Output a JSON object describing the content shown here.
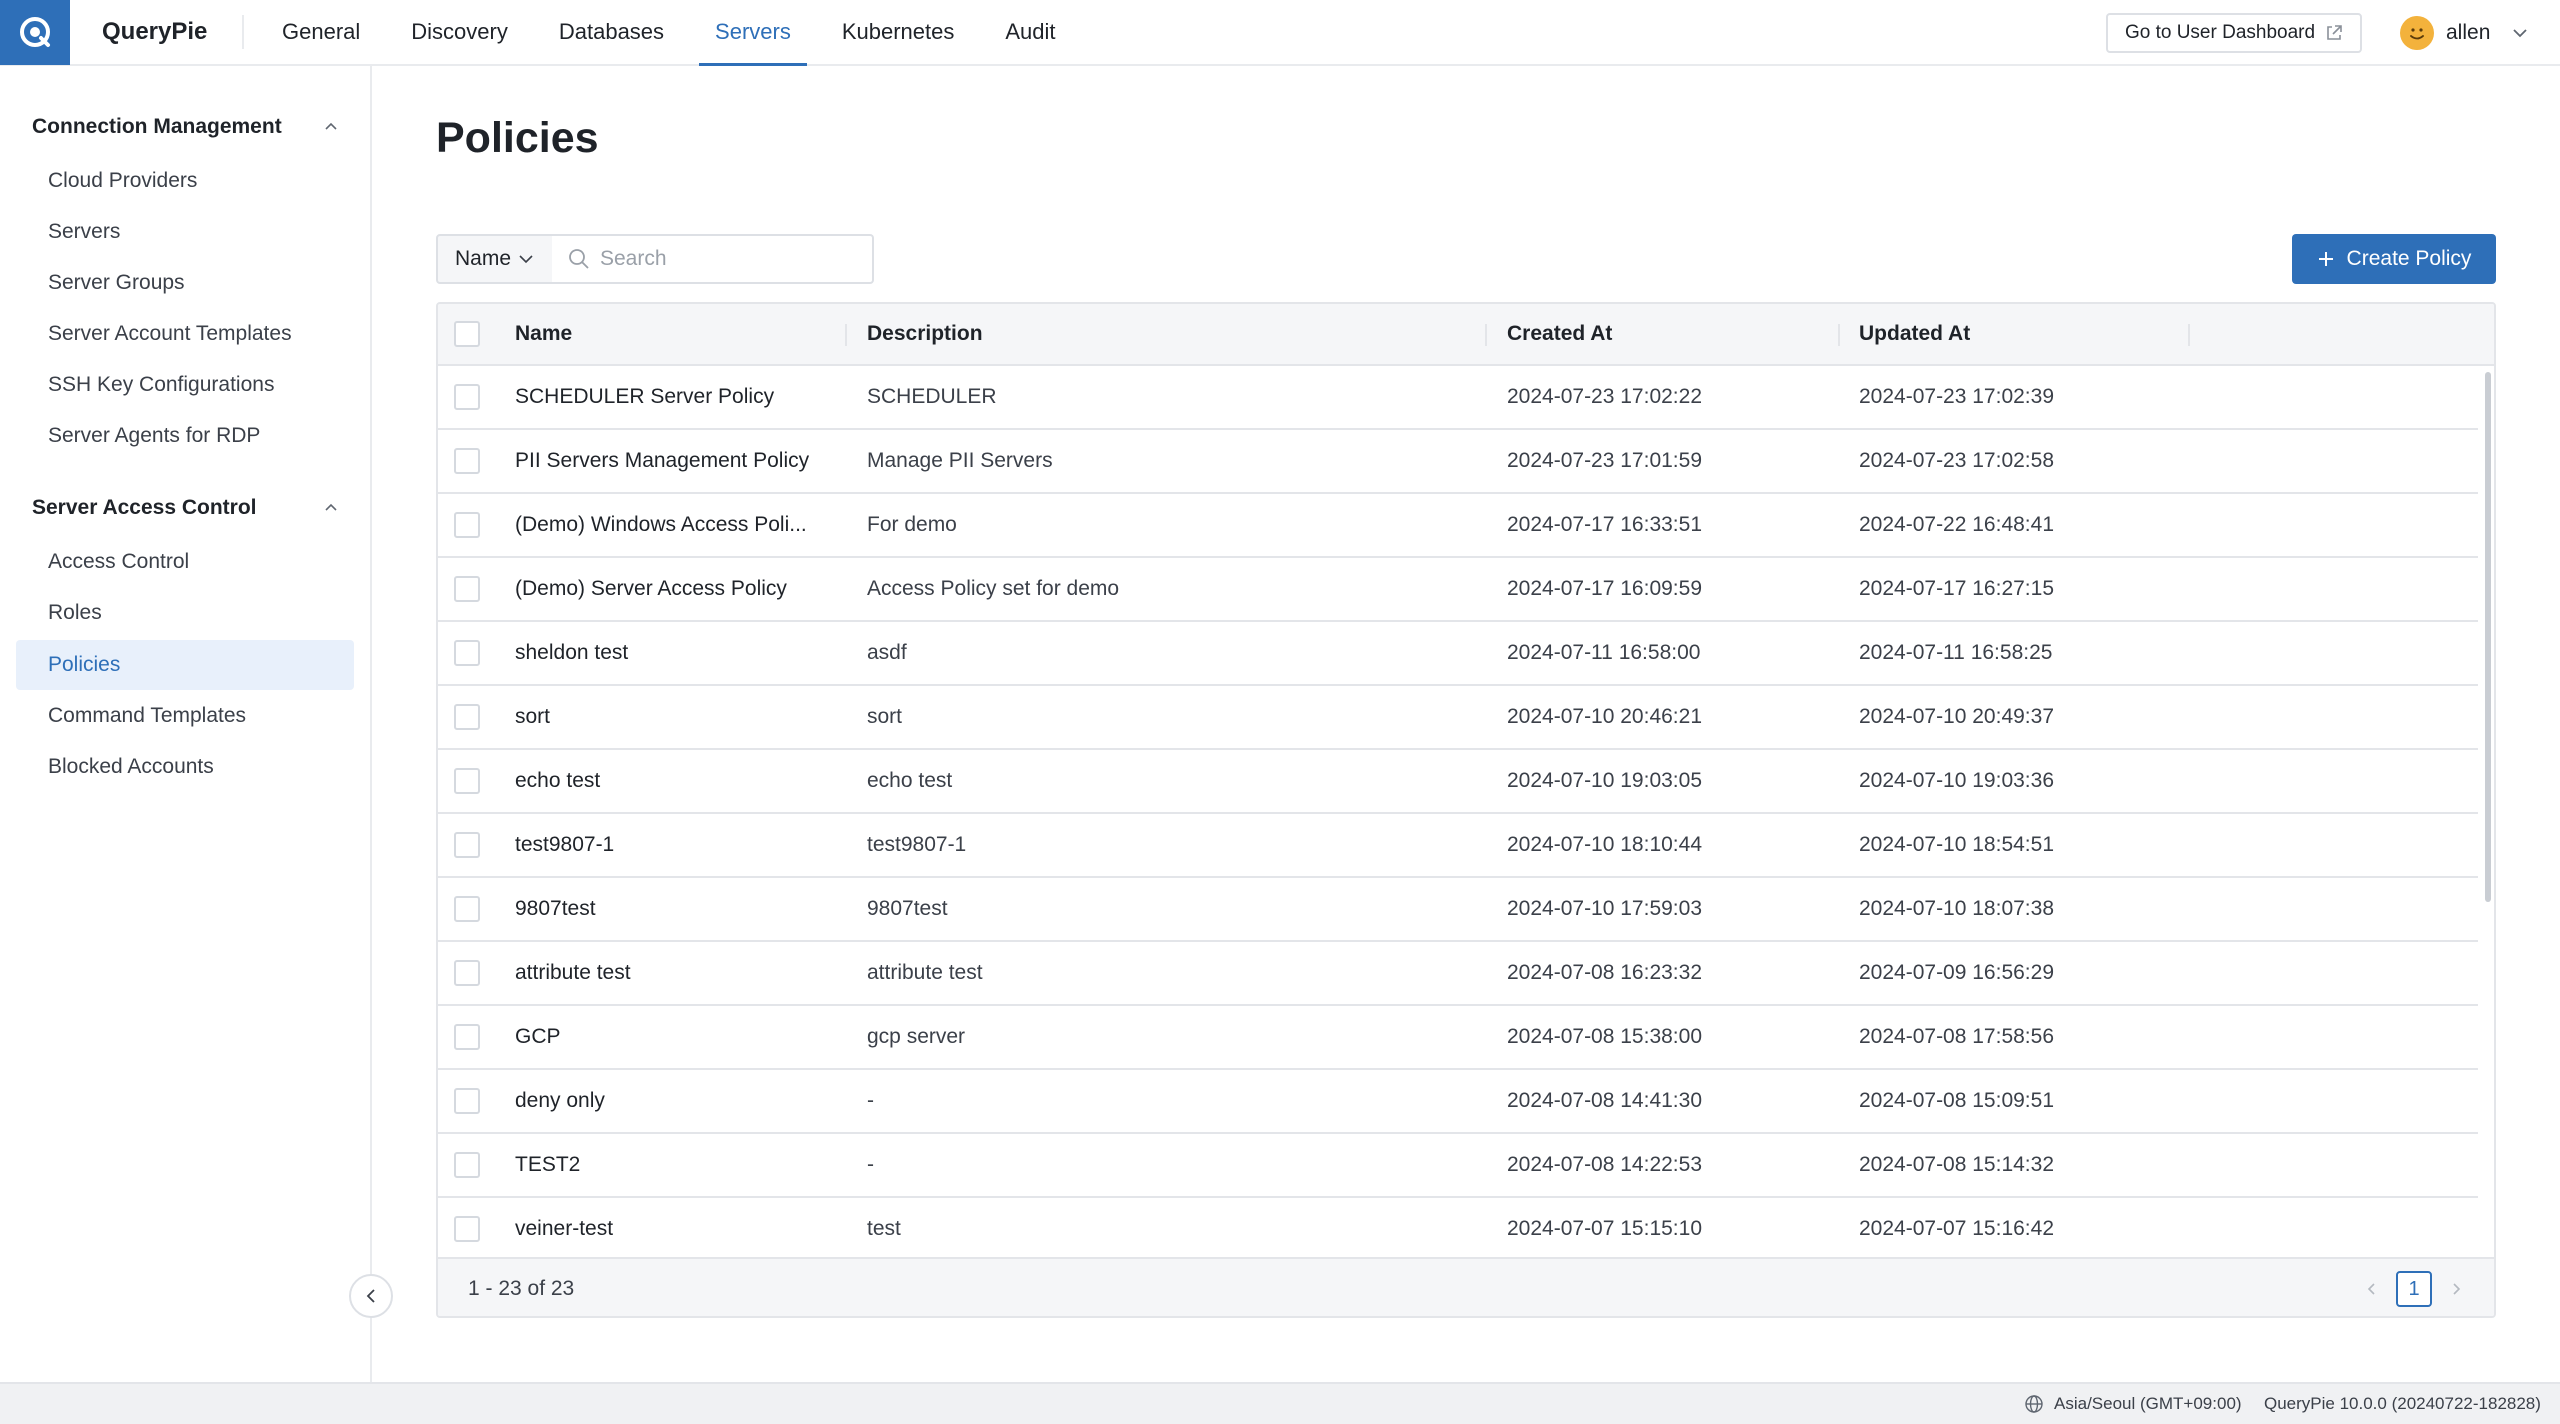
{
  "app": {
    "brand": "QueryPie"
  },
  "nav": [
    {
      "label": "General",
      "active": false
    },
    {
      "label": "Discovery",
      "active": false
    },
    {
      "label": "Databases",
      "active": false
    },
    {
      "label": "Servers",
      "active": true
    },
    {
      "label": "Kubernetes",
      "active": false
    },
    {
      "label": "Audit",
      "active": false
    }
  ],
  "header": {
    "dashboard_label": "Go to User Dashboard",
    "user_name": "allen"
  },
  "sidebar": {
    "sections": [
      {
        "title": "Connection Management",
        "items": [
          {
            "label": "Cloud Providers"
          },
          {
            "label": "Servers"
          },
          {
            "label": "Server Groups"
          },
          {
            "label": "Server Account Templates"
          },
          {
            "label": "SSH Key Configurations"
          },
          {
            "label": "Server Agents for RDP"
          }
        ]
      },
      {
        "title": "Server Access Control",
        "items": [
          {
            "label": "Access Control"
          },
          {
            "label": "Roles"
          },
          {
            "label": "Policies",
            "active": true
          },
          {
            "label": "Command Templates"
          },
          {
            "label": "Blocked Accounts"
          }
        ]
      }
    ]
  },
  "main": {
    "title": "Policies",
    "filter_field": "Name",
    "search_placeholder": "Search",
    "create_label": "Create Policy"
  },
  "table": {
    "columns": [
      "Name",
      "Description",
      "Created At",
      "Updated At"
    ],
    "rows": [
      [
        "SCHEDULER Server Policy",
        "SCHEDULER",
        "2024-07-23 17:02:22",
        "2024-07-23 17:02:39"
      ],
      [
        "PII Servers Management Policy",
        "Manage PII Servers",
        "2024-07-23 17:01:59",
        "2024-07-23 17:02:58"
      ],
      [
        "(Demo) Windows Access Poli...",
        "For demo",
        "2024-07-17 16:33:51",
        "2024-07-22 16:48:41"
      ],
      [
        "(Demo) Server Access Policy",
        "Access Policy set for demo",
        "2024-07-17 16:09:59",
        "2024-07-17 16:27:15"
      ],
      [
        "sheldon test",
        "asdf",
        "2024-07-11 16:58:00",
        "2024-07-11 16:58:25"
      ],
      [
        "sort",
        "sort",
        "2024-07-10 20:46:21",
        "2024-07-10 20:49:37"
      ],
      [
        "echo test",
        "echo test",
        "2024-07-10 19:03:05",
        "2024-07-10 19:03:36"
      ],
      [
        "test9807-1",
        "test9807-1",
        "2024-07-10 18:10:44",
        "2024-07-10 18:54:51"
      ],
      [
        "9807test",
        "9807test",
        "2024-07-10 17:59:03",
        "2024-07-10 18:07:38"
      ],
      [
        "attribute test",
        "attribute test",
        "2024-07-08 16:23:32",
        "2024-07-09 16:56:29"
      ],
      [
        "GCP",
        "gcp server",
        "2024-07-08 15:38:00",
        "2024-07-08 17:58:56"
      ],
      [
        "deny only",
        "-",
        "2024-07-08 14:41:30",
        "2024-07-08 15:09:51"
      ],
      [
        "TEST2",
        "-",
        "2024-07-08 14:22:53",
        "2024-07-08 15:14:32"
      ],
      [
        "veiner-test",
        "test",
        "2024-07-07 15:15:10",
        "2024-07-07 15:16:42"
      ]
    ],
    "range_text": "1 - 23 of 23",
    "current_page": "1"
  },
  "status": {
    "timezone": "Asia/Seoul (GMT+09:00)",
    "version": "QueryPie 10.0.0 (20240722-182828)"
  },
  "colors": {
    "accent": "#2e6fb8",
    "active_bg": "#e8f0fb",
    "border": "#e3e5e9"
  }
}
